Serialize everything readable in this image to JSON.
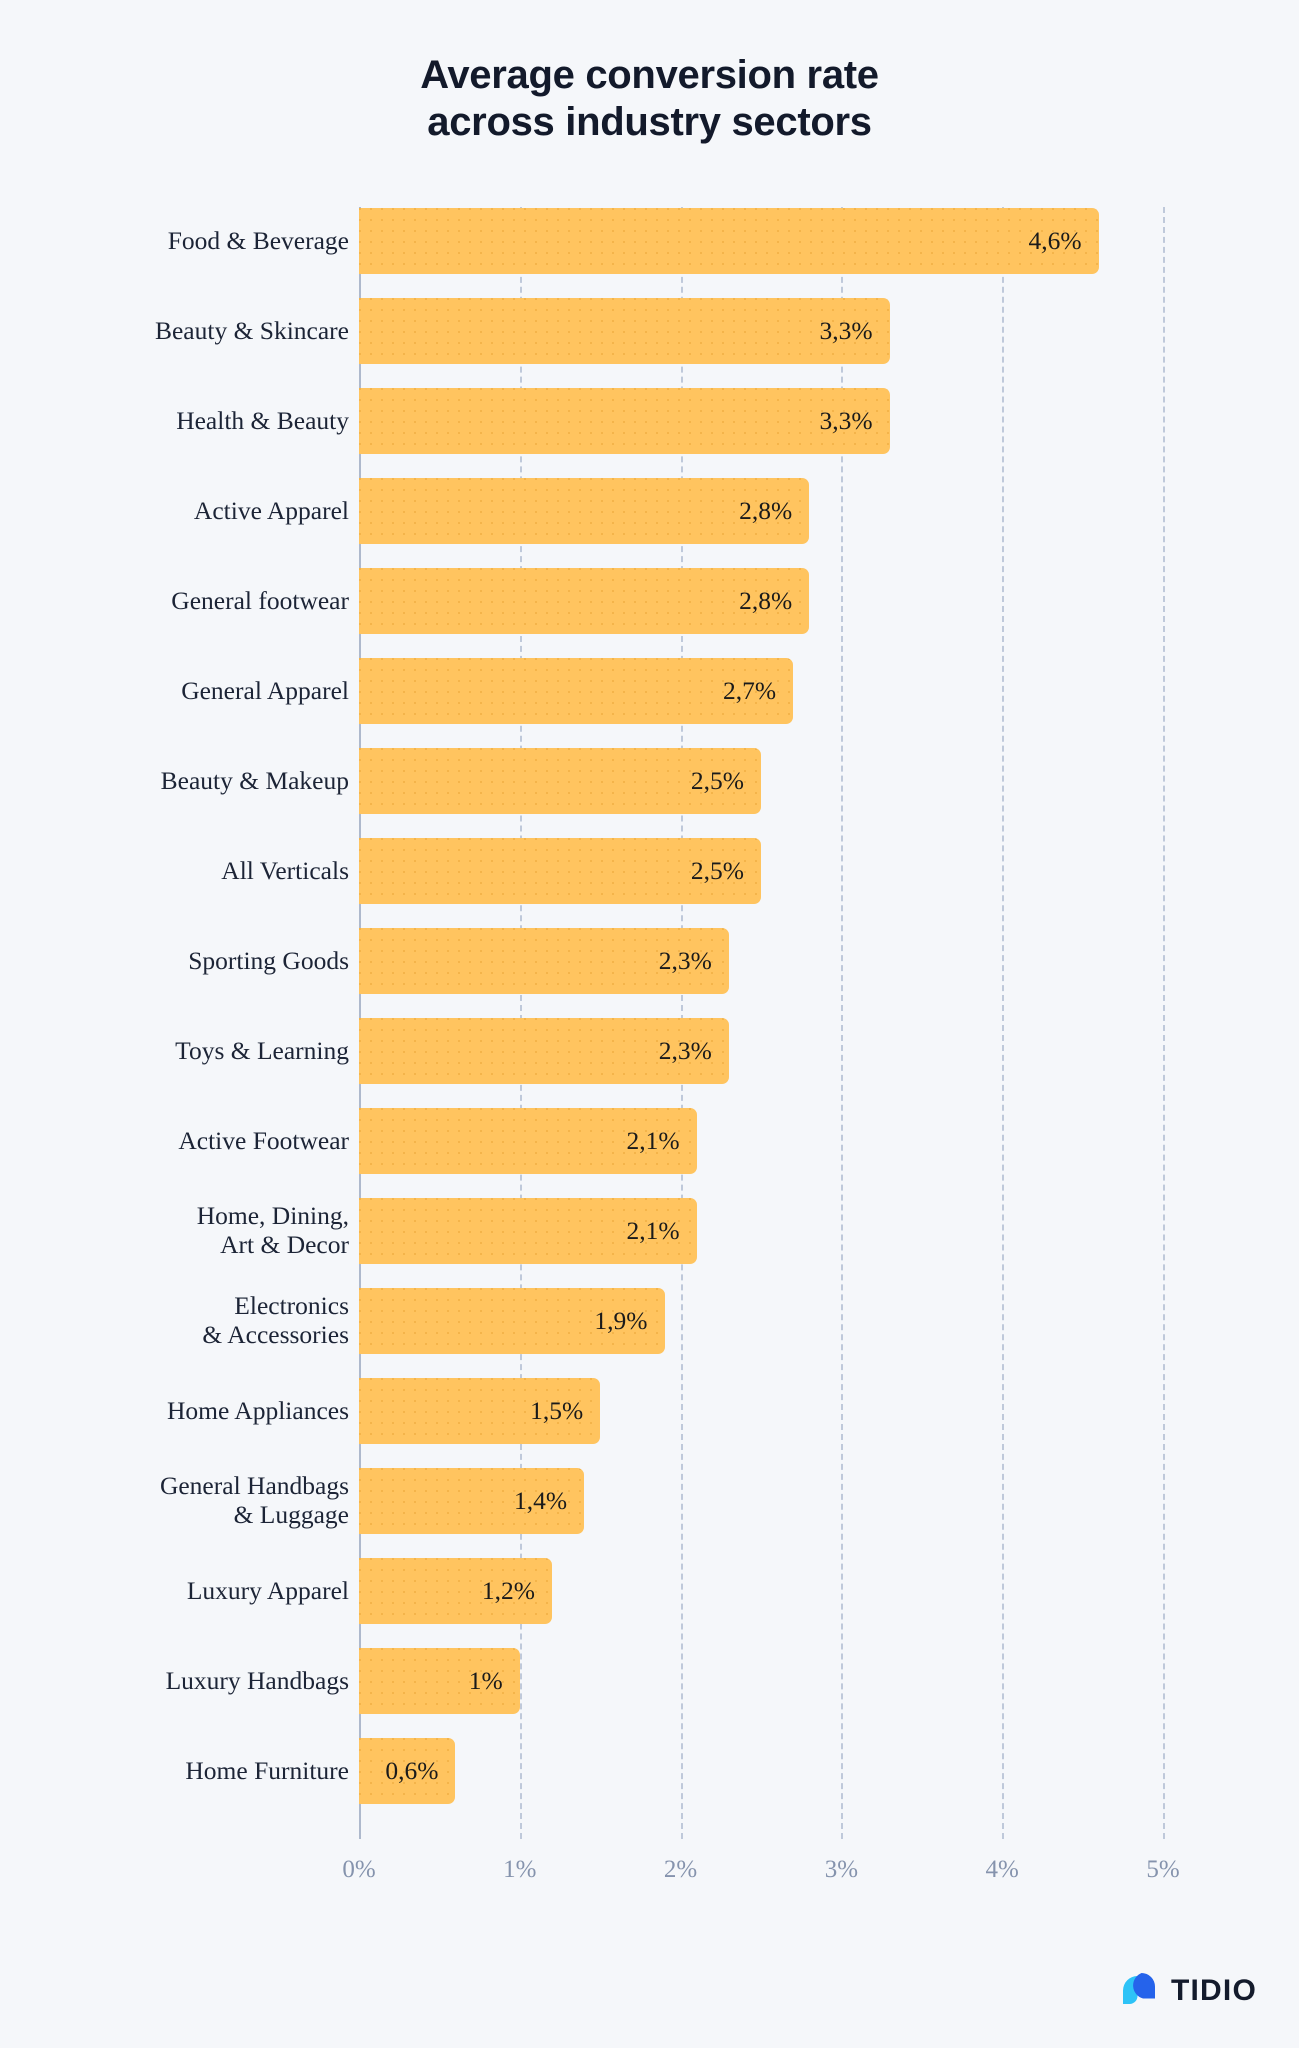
{
  "title": {
    "line1": "Average conversion rate",
    "line2": "across industry sectors"
  },
  "colors": {
    "background": "#F5F7FA",
    "bar": "#FFC45F",
    "title_text": "#131A2B",
    "category_text": "#1C2436",
    "value_text": "#1A1A1A",
    "axis_tick_text": "#8593AD",
    "gridline": "#BFC9DA",
    "zero_axis": "#AEB9CC",
    "logo_dark_blue": "#2563EB",
    "logo_light_blue": "#2DC3F7",
    "logo_text": "#141B2C"
  },
  "logo": {
    "name": "TIDIO",
    "mark": "tidio-chat-bubble-icon"
  },
  "chart_data": {
    "type": "bar",
    "orientation": "horizontal",
    "title": "Average conversion rate across industry sectors",
    "xlabel": "",
    "ylabel": "",
    "xlim": [
      0,
      5
    ],
    "xticks": [
      "0%",
      "1%",
      "2%",
      "3%",
      "4%",
      "5%"
    ],
    "xtick_values": [
      0,
      1,
      2,
      3,
      4,
      5
    ],
    "grid": "vertical-dashed",
    "legend": "none",
    "decimal_separator": ",",
    "categories": [
      "Food & Beverage",
      "Beauty & Skincare",
      "Health & Beauty",
      "Active Apparel",
      "General footwear",
      "General Apparel",
      "Beauty & Makeup",
      "All Verticals",
      "Sporting Goods",
      "Toys & Learning",
      "Active Footwear",
      "Home, Dining,\nArt & Decor",
      "Electronics\n& Accessories",
      "Home Appliances",
      "General Handbags\n& Luggage",
      "Luxury Apparel",
      "Luxury Handbags",
      "Home Furniture"
    ],
    "values": [
      4.6,
      3.3,
      3.3,
      2.8,
      2.8,
      2.7,
      2.5,
      2.5,
      2.3,
      2.3,
      2.1,
      2.1,
      1.9,
      1.5,
      1.4,
      1.2,
      1.0,
      0.6
    ],
    "value_labels": [
      "4,6%",
      "3,3%",
      "3,3%",
      "2,8%",
      "2,8%",
      "2,7%",
      "2,5%",
      "2,5%",
      "2,3%",
      "2,3%",
      "2,1%",
      "2,1%",
      "1,9%",
      "1,5%",
      "1,4%",
      "1,2%",
      "1%",
      "0,6%"
    ]
  }
}
